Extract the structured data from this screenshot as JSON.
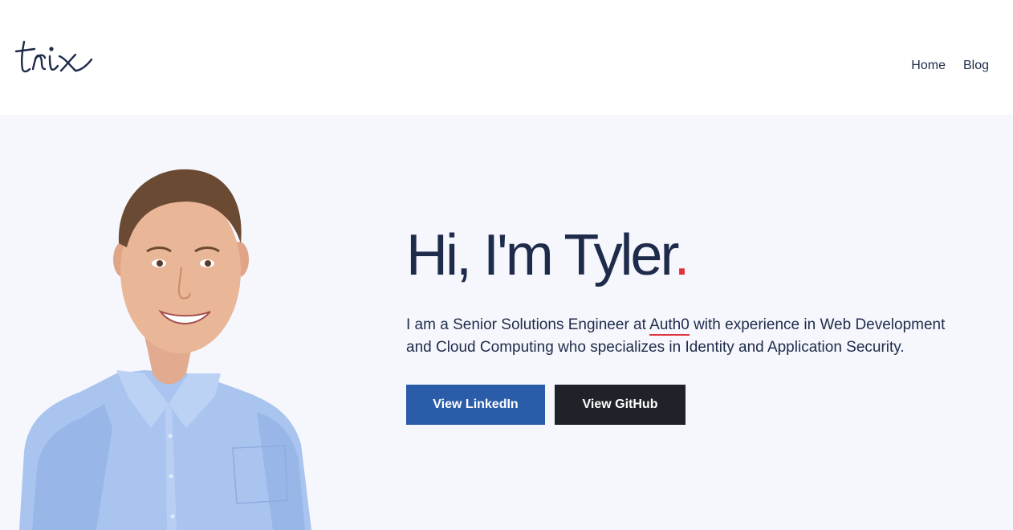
{
  "header": {
    "logo_text": "tnix",
    "nav": [
      {
        "label": "Home"
      },
      {
        "label": "Blog"
      }
    ]
  },
  "hero": {
    "title_main": "Hi, I'm Tyler",
    "title_dot": ".",
    "intro_before": "I am a Senior Solutions Engineer at ",
    "intro_link": "Auth0",
    "intro_after": " with experience in Web Development and Cloud Computing who specializes in Identity and Application Security.",
    "buttons": {
      "linkedin": "View LinkedIn",
      "github": "View GitHub"
    }
  },
  "colors": {
    "text": "#1e2b4b",
    "accent": "#e0323d",
    "linkedin_button": "#2a5ca9",
    "github_button": "#1f2228",
    "hero_background": "#f6f7fc"
  }
}
